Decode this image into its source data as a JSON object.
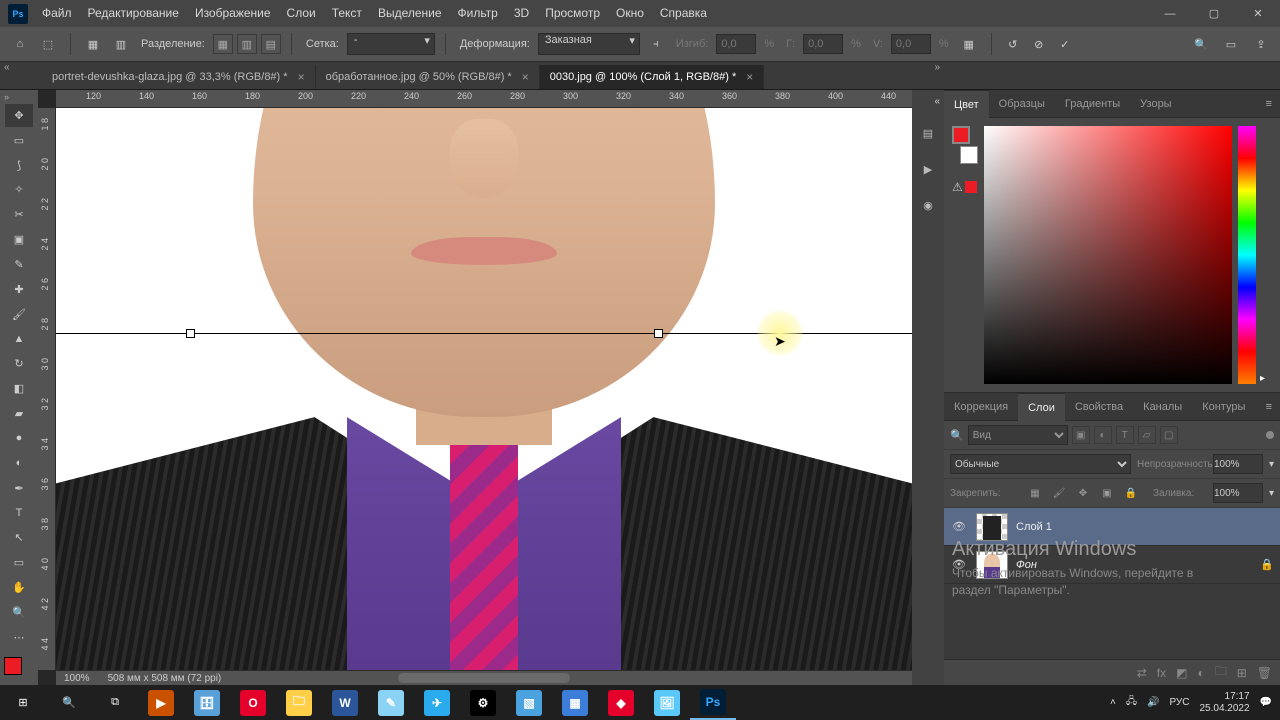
{
  "menu": {
    "items": [
      "Файл",
      "Редактирование",
      "Изображение",
      "Слои",
      "Текст",
      "Выделение",
      "Фильтр",
      "3D",
      "Просмотр",
      "Окно",
      "Справка"
    ]
  },
  "options": {
    "split_label": "Разделение:",
    "grid_label": "Сетка:",
    "grid_value": "-",
    "warp_label": "Деформация:",
    "warp_value": "Заказная",
    "bend_label": "Изгиб:",
    "bend_val": "0,0",
    "pct": "%",
    "h_label": "Г:",
    "h_val": "0,0",
    "v_label": "V:",
    "v_val": "0,0"
  },
  "tabs": [
    {
      "title": "portret-devushka-glaza.jpg @ 33,3% (RGB/8#) *"
    },
    {
      "title": "обработанное.jpg @ 50% (RGB/8#) *"
    },
    {
      "title": "0030.jpg @ 100% (Слой 1, RGB/8#) *"
    }
  ],
  "ruler_h": [
    "120",
    "140",
    "160",
    "180",
    "200",
    "220",
    "240",
    "260",
    "280",
    "300",
    "320",
    "340",
    "360",
    "380",
    "400",
    "440"
  ],
  "ruler_v": [
    "1 8",
    "2 0",
    "2 2",
    "2 4",
    "2 6",
    "2 8",
    "3 0",
    "3 2",
    "3 4",
    "3 6",
    "3 8",
    "4 0",
    "4 2",
    "4 4"
  ],
  "status": {
    "zoom": "100%",
    "dims": "508 мм x 508 мм (72 ppi)"
  },
  "panel_color": {
    "tabs": [
      "Цвет",
      "Образцы",
      "Градиенты",
      "Узоры"
    ],
    "active": 0
  },
  "panel_layers": {
    "tabs": [
      "Коррекция",
      "Слои",
      "Свойства",
      "Каналы",
      "Контуры"
    ],
    "active": 1,
    "search_kind": "Вид",
    "blend": "Обычные",
    "opacity_label": "Непрозрачность:",
    "opacity": "100%",
    "lock_label": "Закрепить:",
    "fill_label": "Заливка:",
    "fill": "100%",
    "layers": [
      {
        "name": "Слой 1",
        "selected": true,
        "locked": false,
        "chk": true
      },
      {
        "name": "Фон",
        "selected": false,
        "locked": true,
        "chk": false
      }
    ]
  },
  "watermark": {
    "title": "Активация Windows",
    "body": "Чтобы активировать Windows, перейдите в раздел \"Параметры\"."
  },
  "tray": {
    "net": "",
    "lang": "РУС",
    "time": "17:17",
    "date": "25.04.2022"
  }
}
